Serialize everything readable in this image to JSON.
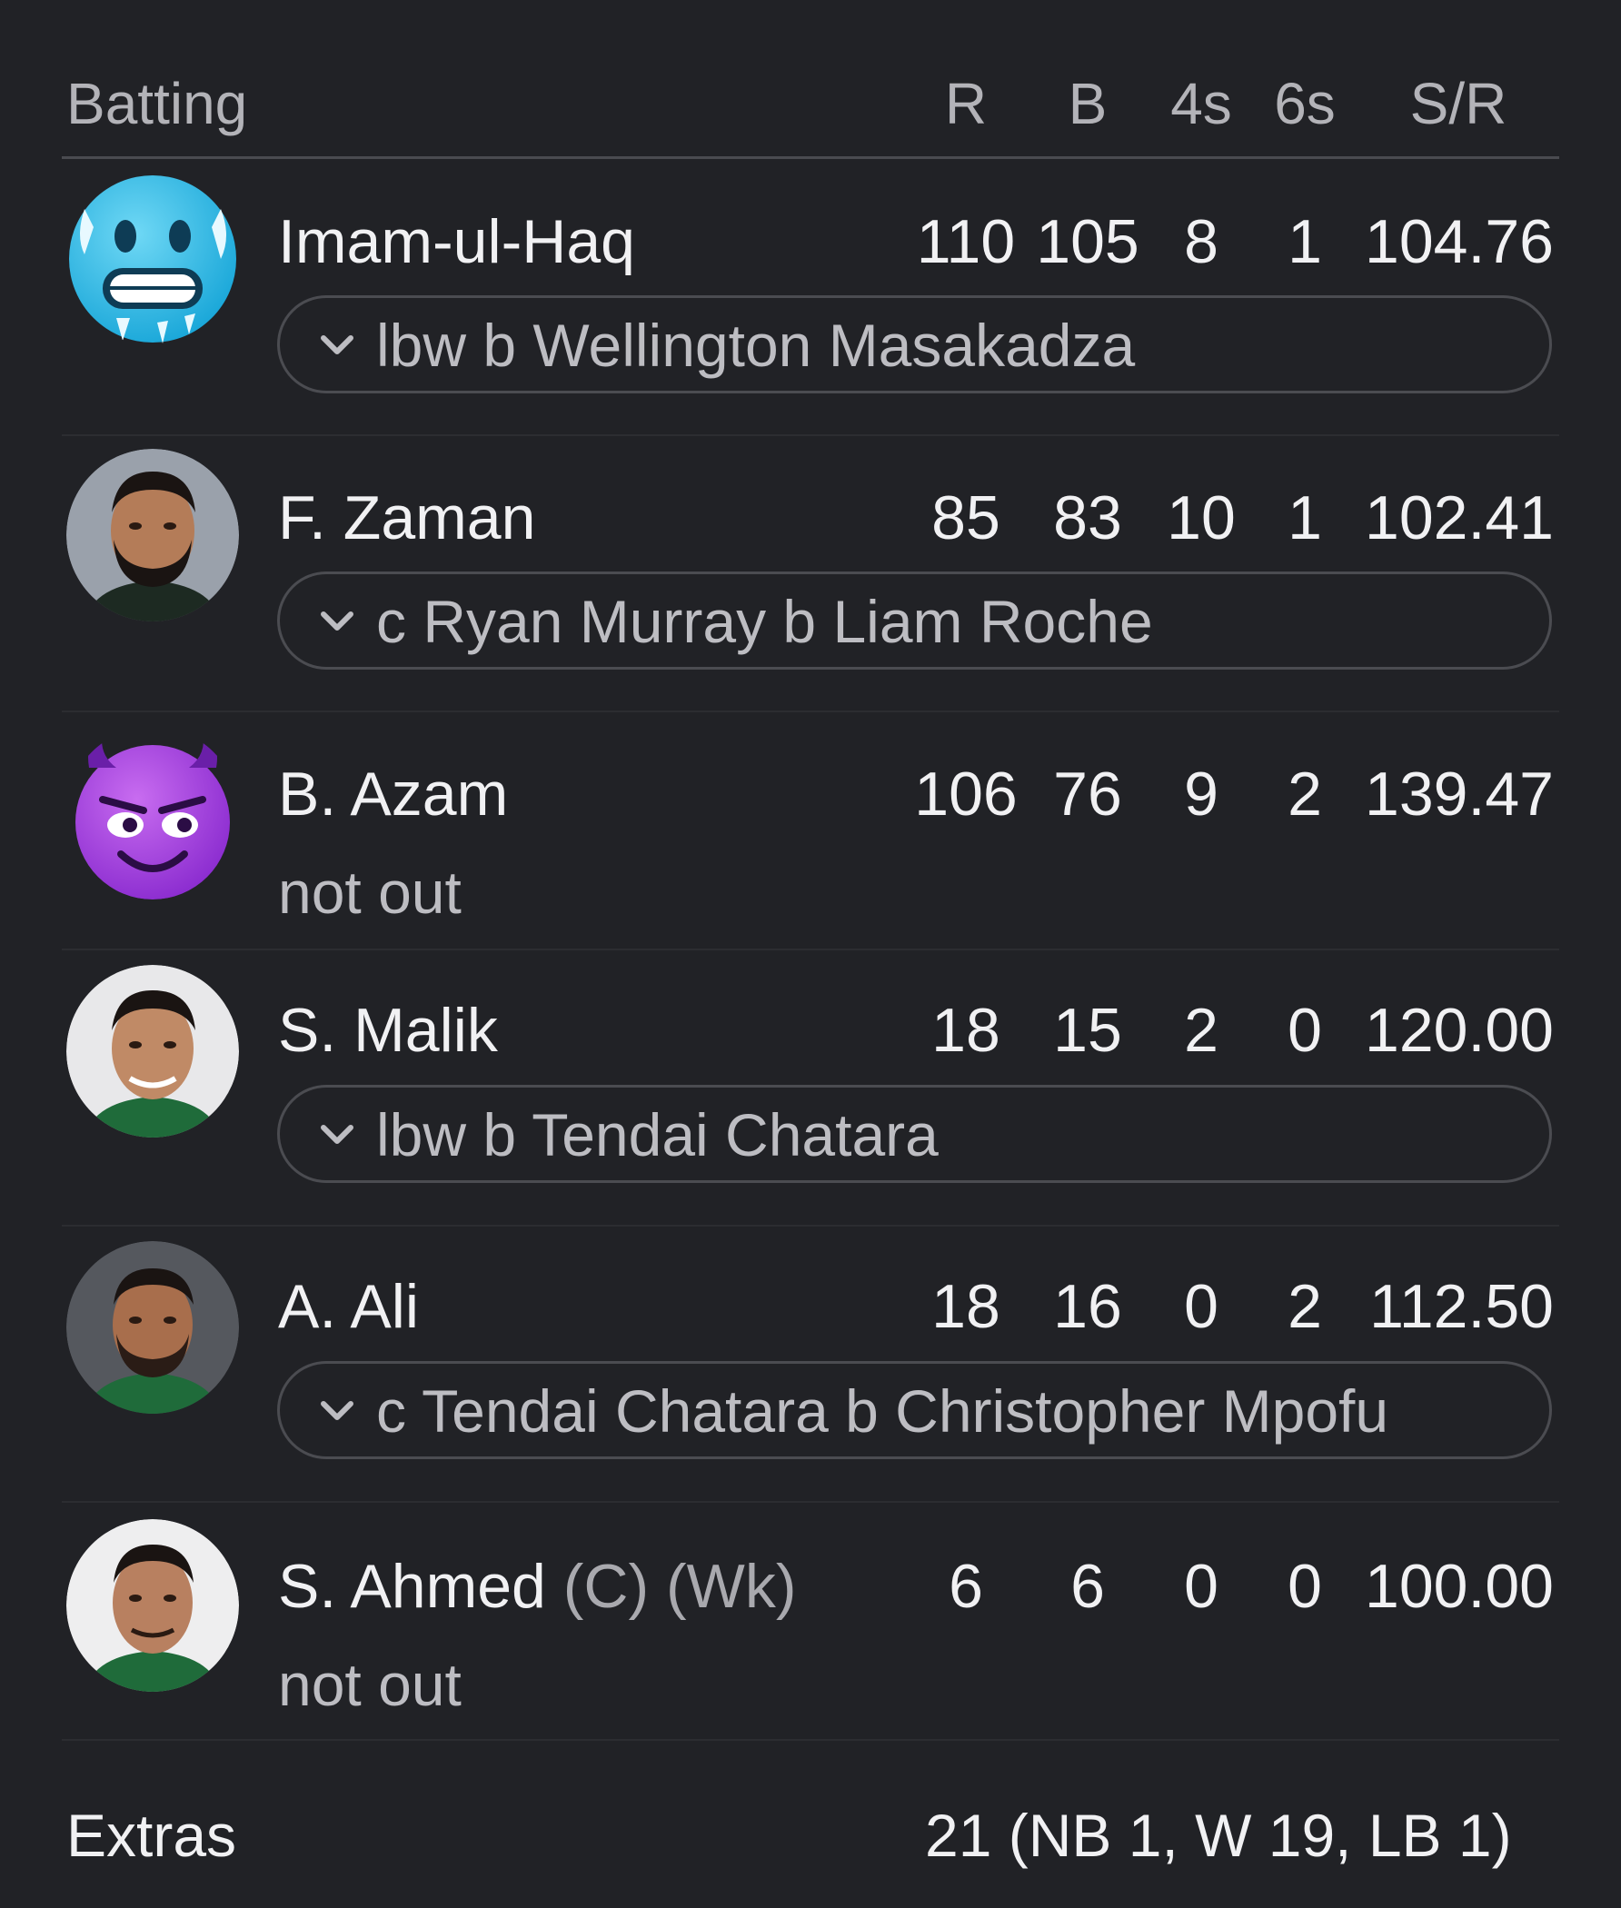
{
  "header": {
    "batting_label": "Batting",
    "columns": [
      "R",
      "B",
      "4s",
      "6s",
      "S/R"
    ]
  },
  "batters": [
    {
      "name": "Imam-ul-Haq",
      "tags": "",
      "avatar": "cold-face-emoji-icon",
      "r": "110",
      "b": "105",
      "fours": "8",
      "sixes": "1",
      "sr": "104.76",
      "dismissal": "lbw b Wellington Masakadza",
      "out": true
    },
    {
      "name": "F. Zaman",
      "tags": "",
      "avatar": "player-photo-icon",
      "r": "85",
      "b": "83",
      "fours": "10",
      "sixes": "1",
      "sr": "102.41",
      "dismissal": "c Ryan Murray b Liam Roche",
      "out": true
    },
    {
      "name": "B. Azam",
      "tags": "",
      "avatar": "smiling-devil-emoji-icon",
      "r": "106",
      "b": "76",
      "fours": "9",
      "sixes": "2",
      "sr": "139.47",
      "dismissal": "not out",
      "out": false
    },
    {
      "name": "S. Malik",
      "tags": "",
      "avatar": "player-photo-icon",
      "r": "18",
      "b": "15",
      "fours": "2",
      "sixes": "0",
      "sr": "120.00",
      "dismissal": "lbw b Tendai Chatara",
      "out": true
    },
    {
      "name": "A. Ali",
      "tags": "",
      "avatar": "player-photo-icon",
      "r": "18",
      "b": "16",
      "fours": "0",
      "sixes": "2",
      "sr": "112.50",
      "dismissal": "c Tendai Chatara b Christopher Mpofu",
      "out": true
    },
    {
      "name": "S. Ahmed",
      "tags": "(C) (Wk)",
      "avatar": "player-photo-icon",
      "r": "6",
      "b": "6",
      "fours": "0",
      "sixes": "0",
      "sr": "100.00",
      "dismissal": "not out",
      "out": false
    }
  ],
  "extras": {
    "label": "Extras",
    "value": "21  (NB 1, W 19, LB 1)"
  },
  "colors": {
    "background": "#212226",
    "text": "#f1f1f3",
    "muted": "#bdbdc2",
    "pill_border": "#4b4c51"
  }
}
